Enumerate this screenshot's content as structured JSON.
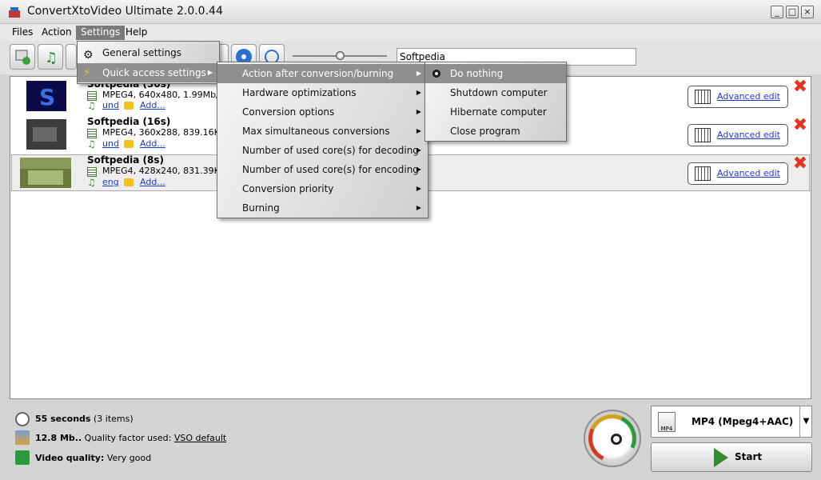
{
  "window": {
    "title": "ConvertXtoVideo Ultimate 2.0.0.44",
    "controls": [
      "_",
      "□",
      "×"
    ]
  },
  "menubar": [
    "Files",
    "Action",
    "Settings",
    "Help"
  ],
  "toolbar": {
    "search_value": "Softpedia"
  },
  "files": [
    {
      "name": "Softpedia (30s)",
      "info": "MPEG4, 640x480, 1.99Mb/s,",
      "audio": "und",
      "subtitle": "Add...",
      "advanced": "Advanced edit",
      "thumb_color": "#1a1aa8"
    },
    {
      "name": "Softpedia (16s)",
      "info": "MPEG4, 360x288, 839.16Kb/s",
      "audio": "und",
      "subtitle": "Add...",
      "advanced": "Advanced edit",
      "thumb_color": "#3c3c3c"
    },
    {
      "name": "Softpedia (8s)",
      "info": "MPEG4, 428x240, 831.39Kb/s",
      "audio": "eng",
      "subtitle": "Add...",
      "advanced": "Advanced edit",
      "thumb_color": "#6a7a3c"
    }
  ],
  "status": {
    "duration": "55 seconds",
    "items": "(3 items)",
    "size": "12.8 Mb..",
    "quality_factor_label": "Quality factor used:",
    "quality_factor_value": "VSO default",
    "video_quality_label": "Video quality:",
    "video_quality_value": "Very good"
  },
  "profile": {
    "label": "MP4 (Mpeg4+AAC)",
    "icon_text": "MP4"
  },
  "start_label": "Start",
  "settings_menu": {
    "items": [
      "General settings",
      "Quick access settings"
    ]
  },
  "quick_menu": {
    "items": [
      "Action after conversion/burning",
      "Hardware optimizations",
      "Conversion options",
      "Max simultaneous conversions",
      "Number of used core(s) for decoding",
      "Number of used core(s) for encoding",
      "Conversion priority",
      "Burning"
    ]
  },
  "action_menu": {
    "items": [
      "Do nothing",
      "Shutdown computer",
      "Hibernate computer",
      "Close program"
    ],
    "selected": "Do nothing"
  },
  "colors": {
    "link": "#1a3bd1",
    "delete": "#e1361b",
    "start": "#2f8c2f"
  }
}
